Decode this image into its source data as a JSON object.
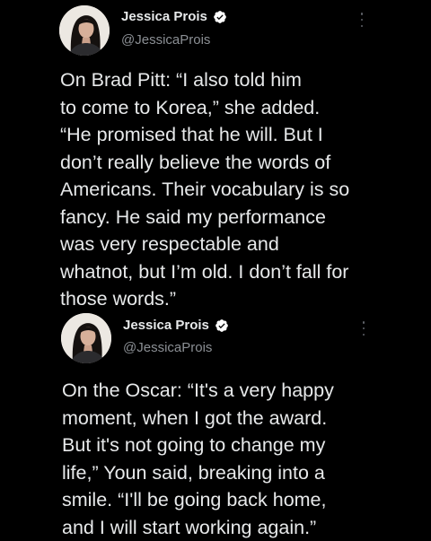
{
  "tweets": [
    {
      "author": {
        "display_name": "Jessica Prois",
        "handle": "@JessicaProis"
      },
      "verified": true,
      "icons": {
        "verified": "verified-badge-icon",
        "more": "more-vertical-icon"
      },
      "text_lines": [
        "On Brad Pitt: “I also told him",
        "to come to Korea,” she added.",
        "“He promised that he will. But I",
        "don’t really believe the words of",
        "Americans. Their vocabulary is so",
        "fancy. He said my performance",
        "was very respectable and",
        "whatnot, but I’m old. I don’t fall for",
        "those words.”"
      ]
    },
    {
      "author": {
        "display_name": "Jessica Prois",
        "handle": "@JessicaProis"
      },
      "verified": true,
      "icons": {
        "verified": "verified-badge-icon",
        "more": "more-vertical-icon"
      },
      "text_lines": [
        "On the Oscar: “It's a very happy",
        "moment, when I got the award.",
        "But it's not going to change my",
        "life,” Youn said, breaking into a",
        "smile. “I'll be going back home,",
        "and I will start working again.”"
      ]
    }
  ],
  "colors": {
    "background": "#000000",
    "text": "#e7e9ea",
    "secondary_text": "#8b8f94",
    "verified_badge": "#ffffff"
  }
}
